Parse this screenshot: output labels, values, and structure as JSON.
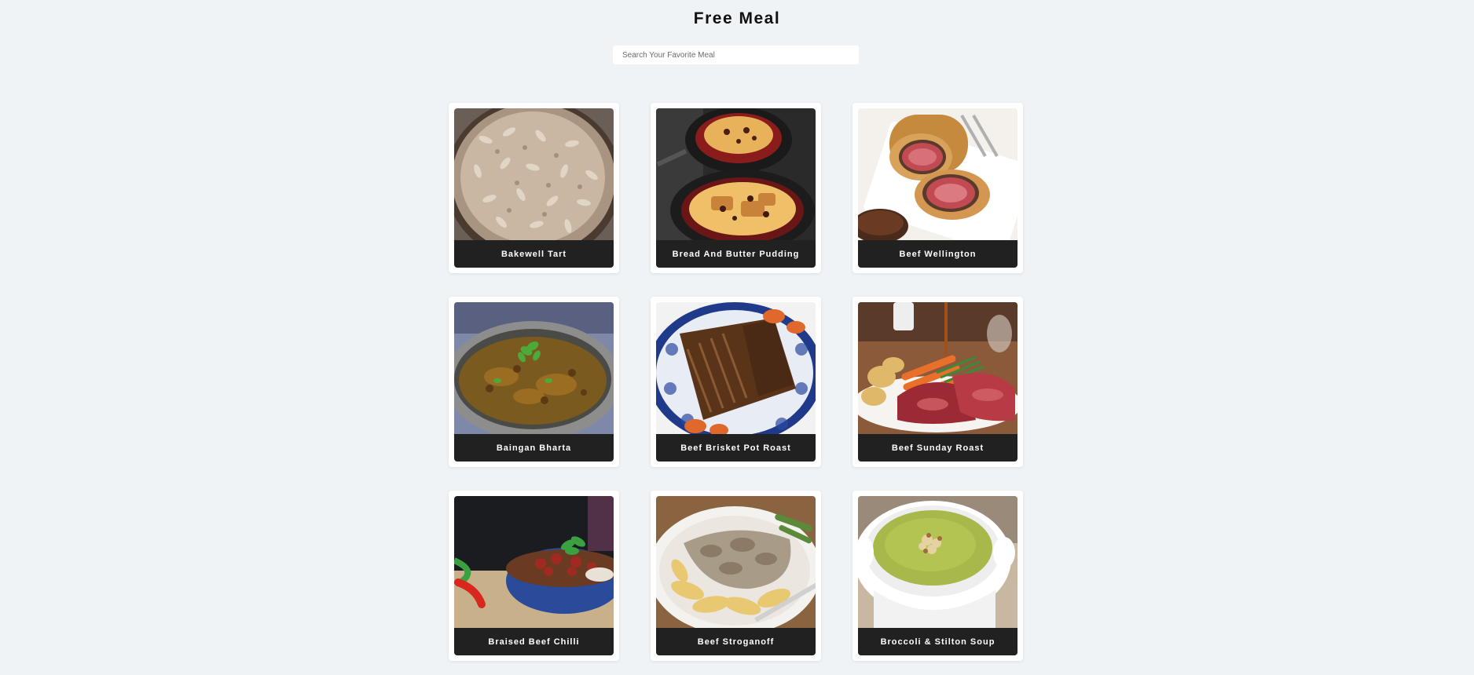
{
  "header": {
    "title": "Free Meal"
  },
  "search": {
    "placeholder": "Search Your Favorite Meal",
    "value": ""
  },
  "meals": [
    {
      "name": "Bakewell Tart",
      "image": "bakewell-tart-photo"
    },
    {
      "name": "Bread And Butter Pudding",
      "image": "bread-and-butter-pudding-photo"
    },
    {
      "name": "Beef Wellington",
      "image": "beef-wellington-photo"
    },
    {
      "name": "Baingan Bharta",
      "image": "baingan-bharta-photo"
    },
    {
      "name": "Beef Brisket Pot Roast",
      "image": "beef-brisket-pot-roast-photo"
    },
    {
      "name": "Beef Sunday Roast",
      "image": "beef-sunday-roast-photo"
    },
    {
      "name": "Braised Beef Chilli",
      "image": "braised-beef-chilli-photo"
    },
    {
      "name": "Beef Stroganoff",
      "image": "beef-stroganoff-photo"
    },
    {
      "name": "Broccoli & Stilton Soup",
      "image": "broccoli-stilton-soup-photo"
    }
  ],
  "colors": {
    "background": "#f0f3f6",
    "card": "#ffffff",
    "caption_bg": "#212121",
    "caption_text": "#ffffff"
  }
}
